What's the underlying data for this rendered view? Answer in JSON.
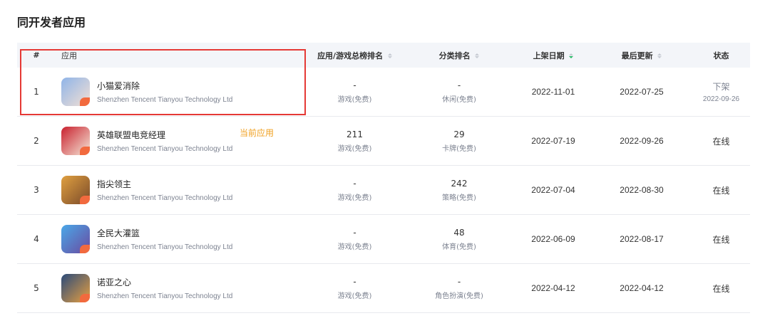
{
  "section": {
    "title": "同开发者应用"
  },
  "table": {
    "headers": {
      "idx": "#",
      "app": "应用",
      "total_rank": "应用/游戏总榜排名",
      "category_rank": "分类排名",
      "listed_date": "上架日期",
      "last_update": "最后更新",
      "status": "状态"
    },
    "rows": [
      {
        "idx": "1",
        "name": "小猫爱消除",
        "developer": "Shenzhen Tencent Tianyou Technology Ltd",
        "tag": "",
        "total_rank": "-",
        "total_rank_sub": "游戏(免费)",
        "category_rank": "-",
        "category_rank_sub": "休闲(免费)",
        "listed_date": "2022-11-01",
        "last_update": "2022-07-25",
        "status": "下架",
        "status_sub": "2022-09-26",
        "icon": "cat-app-icon",
        "icon_colors": [
          "#8fb4e8",
          "#f3e0d4"
        ]
      },
      {
        "idx": "2",
        "name": "英雄联盟电竞经理",
        "developer": "Shenzhen Tencent Tianyou Technology Ltd",
        "tag": "当前应用",
        "total_rank": "211",
        "total_rank_sub": "游戏(免费)",
        "category_rank": "29",
        "category_rank_sub": "卡牌(免费)",
        "listed_date": "2022-07-19",
        "last_update": "2022-09-26",
        "status": "在线",
        "status_sub": "",
        "icon": "lol-esports-icon",
        "icon_colors": [
          "#c9202e",
          "#f5e8d8"
        ]
      },
      {
        "idx": "3",
        "name": "指尖领主",
        "developer": "Shenzhen Tencent Tianyou Technology Ltd",
        "tag": "",
        "total_rank": "-",
        "total_rank_sub": "游戏(免费)",
        "category_rank": "242",
        "category_rank_sub": "策略(免费)",
        "listed_date": "2022-07-04",
        "last_update": "2022-08-30",
        "status": "在线",
        "status_sub": "",
        "icon": "lord-game-icon",
        "icon_colors": [
          "#e0a040",
          "#7a4a2a"
        ]
      },
      {
        "idx": "4",
        "name": "全民大灌篮",
        "developer": "Shenzhen Tencent Tianyou Technology Ltd",
        "tag": "",
        "total_rank": "-",
        "total_rank_sub": "游戏(免费)",
        "category_rank": "48",
        "category_rank_sub": "体育(免费)",
        "listed_date": "2022-06-09",
        "last_update": "2022-08-17",
        "status": "在线",
        "status_sub": "",
        "icon": "basketball-game-icon",
        "icon_colors": [
          "#4aa8e8",
          "#6a4aa0"
        ]
      },
      {
        "idx": "5",
        "name": "诺亚之心",
        "developer": "Shenzhen Tencent Tianyou Technology Ltd",
        "tag": "",
        "total_rank": "-",
        "total_rank_sub": "游戏(免费)",
        "category_rank": "-",
        "category_rank_sub": "角色扮演(免费)",
        "listed_date": "2022-04-12",
        "last_update": "2022-04-12",
        "status": "在线",
        "status_sub": "",
        "icon": "noah-heart-icon",
        "icon_colors": [
          "#2a4a7a",
          "#e8a040"
        ]
      }
    ]
  },
  "colors": {
    "header_bg": "#f3f5f9",
    "highlight_border": "#e53935",
    "current_tag": "#f0a020",
    "sort_active": "#25b864"
  }
}
